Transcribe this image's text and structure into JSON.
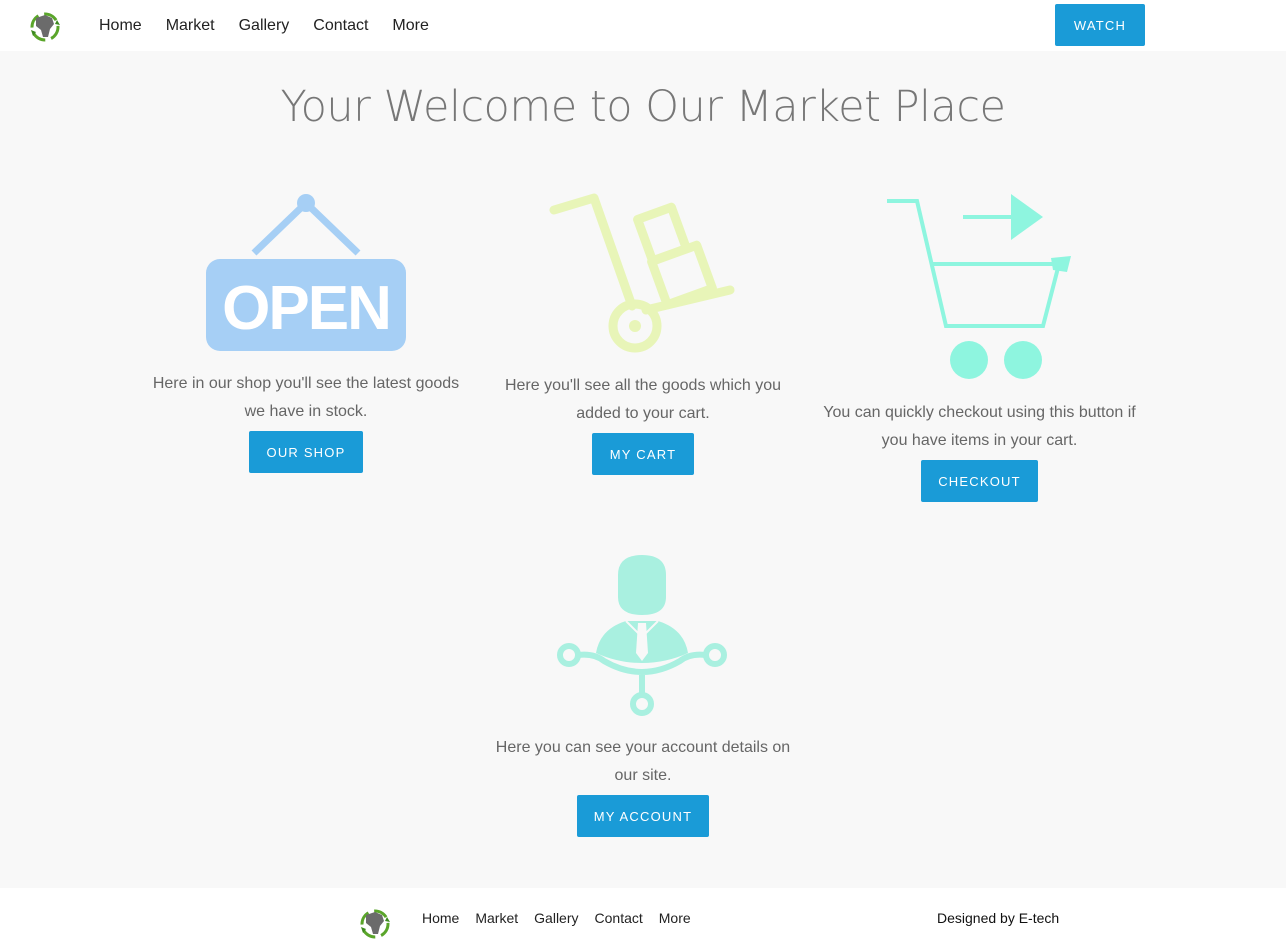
{
  "header": {
    "nav": [
      "Home",
      "Market",
      "Gallery",
      "Contact",
      "More"
    ],
    "watch_label": "WATCH"
  },
  "hero": {
    "title": "Your Welcome to Our Market Place"
  },
  "features": [
    {
      "icon": "open-sign-icon",
      "color": "#a6cff5",
      "sign_text": "OPEN",
      "description": "Here in our shop you'll see the latest goods we have in stock.",
      "button": "OUR SHOP"
    },
    {
      "icon": "hand-truck-icon",
      "color": "#e8f5b8",
      "description": "Here you'll see all the goods which you added to your cart.",
      "button": "MY CART"
    },
    {
      "icon": "cart-checkout-icon",
      "color": "#8ef5df",
      "description": "You can quickly checkout using this button if you have items in your cart.",
      "button": "CHECKOUT"
    },
    {
      "icon": "account-user-icon",
      "color": "#a9f0e0",
      "description": "Here you can see your account details on our site.",
      "button": "MY ACCOUNT"
    }
  ],
  "footer": {
    "nav": [
      "Home",
      "Market",
      "Gallery",
      "Contact",
      "More"
    ],
    "credit": "Designed by E-tech"
  },
  "colors": {
    "accent": "#1a9bd7",
    "background": "#f8f8f8",
    "bar": "#ffffff"
  }
}
